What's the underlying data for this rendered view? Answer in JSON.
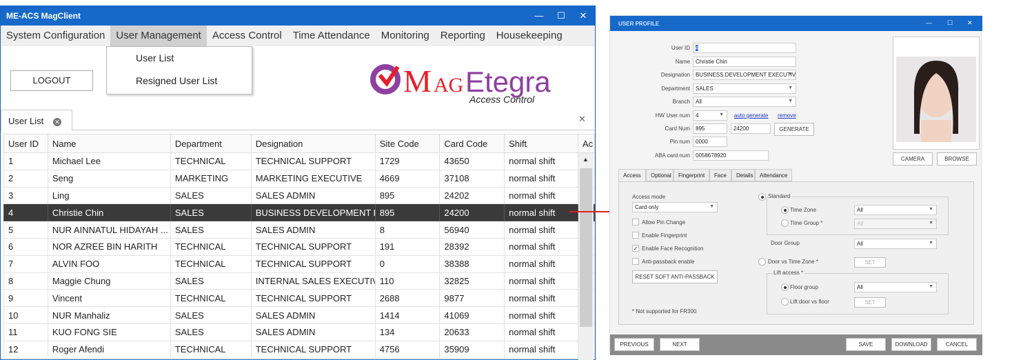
{
  "main_window": {
    "title": "ME-ACS MagClient",
    "controls": [
      "—",
      "☐",
      "✕"
    ],
    "menu": [
      "System Configuration",
      "User Management",
      "Access Control",
      "Time Attendance",
      "Monitoring",
      "Reporting",
      "Housekeeping"
    ],
    "dropdown": [
      "User List",
      "Resigned User List"
    ],
    "logout_label": "LOGOUT",
    "logo": {
      "text": "MAGEtegra",
      "subtitle": "Access Control",
      "colors": {
        "purple": "#8e3fa0",
        "red": "#e5202a"
      }
    },
    "tab": {
      "label": "User List"
    },
    "table": {
      "columns": [
        "User ID",
        "Name",
        "Department",
        "Designation",
        "Site Code",
        "Card Code",
        "Shift",
        "Ac"
      ],
      "rows": [
        [
          "1",
          "Michael Lee",
          "TECHNICAL",
          "TECHNICAL SUPPORT",
          "1729",
          "43650",
          "normal shift"
        ],
        [
          "2",
          "Seng",
          "MARKETING",
          "MARKETING EXECUTIVE",
          "4669",
          "37108",
          "normal shift"
        ],
        [
          "3",
          "Ling",
          "SALES",
          "SALES ADMIN",
          "895",
          "24202",
          "normal shift"
        ],
        [
          "4",
          "Christie Chin",
          "SALES",
          "BUSINESS DEVELOPMENT E...",
          "895",
          "24200",
          "normal shift"
        ],
        [
          "5",
          "NUR AINNATUL HIDAYAH ...",
          "SALES",
          "SALES ADMIN",
          "8",
          "56940",
          "normal shift"
        ],
        [
          "6",
          "NOR AZREE BIN HARITH",
          "TECHNICAL",
          "TECHNICAL SUPPORT",
          "191",
          "28392",
          "normal shift"
        ],
        [
          "7",
          "ALVIN FOO",
          "TECHNICAL",
          "TECHNICAL SUPPORT",
          "0",
          "38388",
          "normal shift"
        ],
        [
          "8",
          "Maggie Chung",
          "SALES",
          "INTERNAL SALES EXECUTIVE",
          "110",
          "32825",
          "normal shift"
        ],
        [
          "9",
          "Vincent",
          "TECHNICAL",
          "TECHNICAL SUPPORT",
          "2688",
          "9877",
          "normal shift"
        ],
        [
          "10",
          "NUR Manhaliz",
          "SALES",
          "SALES ADMIN",
          "1414",
          "41069",
          "normal shift"
        ],
        [
          "11",
          "KUO FONG SIE",
          "SALES",
          "SALES ADMIN",
          "134",
          "20633",
          "normal shift"
        ],
        [
          "12",
          "Roger Afendi",
          "TECHNICAL",
          "TECHNICAL SUPPORT",
          "4756",
          "35909",
          "normal shift"
        ]
      ],
      "selected_index": 3
    }
  },
  "profile": {
    "title": "USER PROFILE",
    "fields": {
      "user_id": {
        "label": "User ID",
        "value": "4"
      },
      "name": {
        "label": "Name",
        "value": "Christie Chin"
      },
      "designation": {
        "label": "Designation",
        "value": "BUSINESS DEVELOPMENT EXECUTIVE"
      },
      "department": {
        "label": "Department",
        "value": "SALES"
      },
      "branch": {
        "label": "Branch",
        "value": "All"
      },
      "hw_user_num": {
        "label": "HW User num",
        "value": "4"
      },
      "card_num": {
        "label": "Card Num",
        "site": "895",
        "card": "24200"
      },
      "pin_num": {
        "label": "Pin num",
        "value": "0000"
      },
      "aba": {
        "label": "ABA card num",
        "value": "0058678920"
      }
    },
    "links": {
      "auto_generate": "auto generate",
      "remove": "remove"
    },
    "generate": "GENERATE",
    "camera": "CAMERA",
    "browse": "BROWSE",
    "tabs": [
      "Access",
      "Optional",
      "Fingerprint",
      "Face",
      "Details",
      "Attendance"
    ],
    "access": {
      "mode_label": "Access mode",
      "mode_value": "Card only",
      "checks": [
        {
          "label": "Allow Pin Change",
          "checked": false
        },
        {
          "label": "Enable Fingerprint",
          "checked": false
        },
        {
          "label": "Enable Face Recognition",
          "checked": true
        },
        {
          "label": "Anti-passback enable",
          "checked": false
        }
      ],
      "reset_btn": "RESET SOFT ANTI-PASSBACK",
      "note": "* Not supported for FR300",
      "standard": "Standard",
      "time_zone": "Time Zone",
      "time_zone_value": "All",
      "time_group": "Time Group *",
      "time_group_value": "All",
      "door_group": "Door Group",
      "door_group_value": "All",
      "door_vs_tz": "Door vs Time Zone *",
      "set": "SET",
      "lift_access": "Lift access *",
      "floor_group": "Floor group",
      "floor_group_value": "All",
      "lift_door": "Lift door vs floor"
    },
    "footer": {
      "previous": "PREVIOUS",
      "next": "NEXT",
      "save": "SAVE",
      "download": "DOWNLOAD",
      "cancel": "CANCEL"
    }
  }
}
